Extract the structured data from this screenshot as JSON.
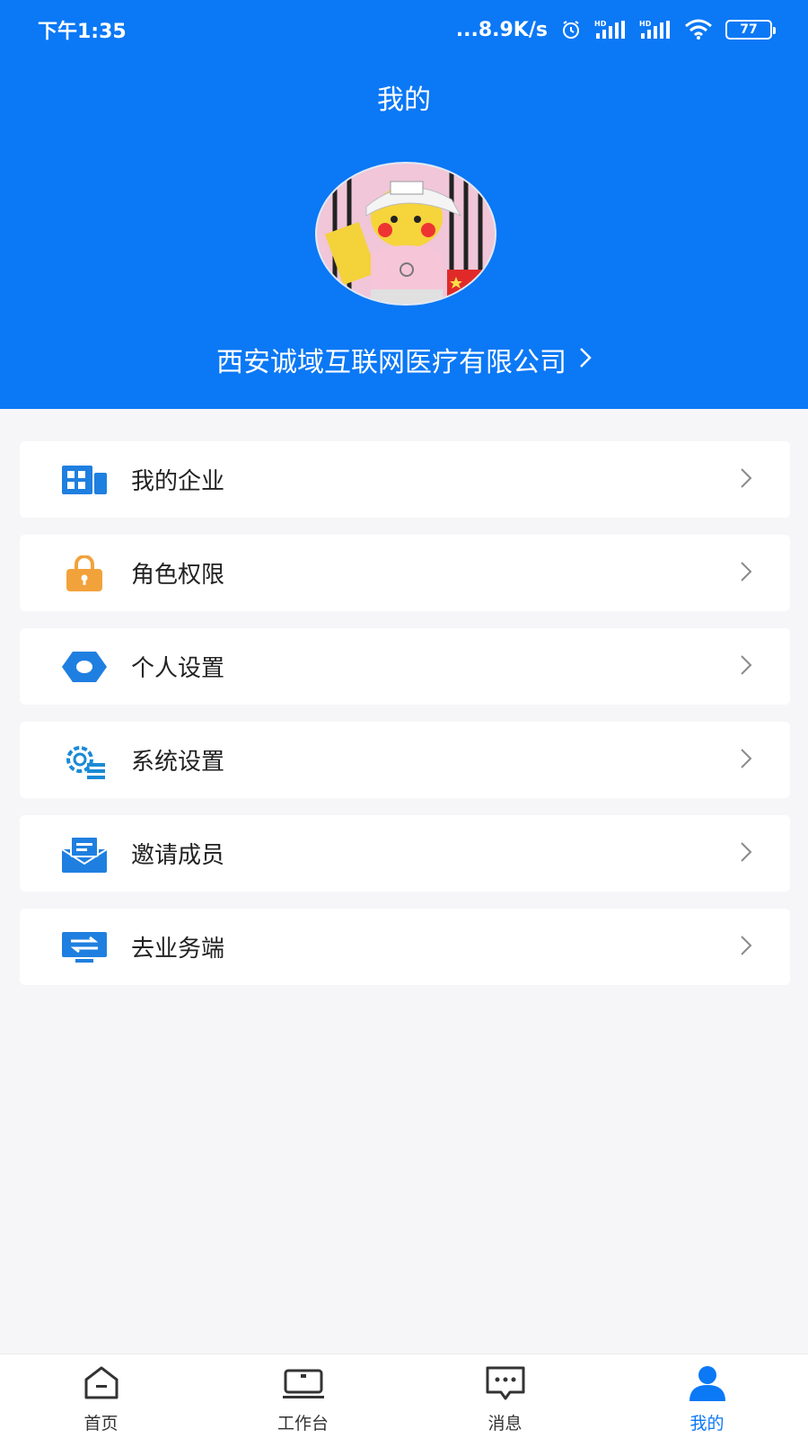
{
  "status_bar": {
    "time": "下午1:35",
    "network_speed": "...8.9K/s",
    "battery": "77",
    "icons": [
      "alarm-icon",
      "signal-hd-icon",
      "signal-hd-icon",
      "wifi-icon",
      "battery-icon"
    ]
  },
  "header": {
    "title": "我的",
    "company_name": "西安诚域互联网医疗有限公司",
    "accent_color": "#0b78f5"
  },
  "menu": {
    "items": [
      {
        "label": "我的企业",
        "icon": "building-icon"
      },
      {
        "label": "角色权限",
        "icon": "lock-icon"
      },
      {
        "label": "个人设置",
        "icon": "hexagon-settings-icon"
      },
      {
        "label": "系统设置",
        "icon": "gear-list-icon"
      },
      {
        "label": "邀请成员",
        "icon": "invite-mail-icon"
      },
      {
        "label": "去业务端",
        "icon": "monitor-switch-icon"
      }
    ]
  },
  "tabbar": {
    "tabs": [
      {
        "label": "首页",
        "icon": "home-icon"
      },
      {
        "label": "工作台",
        "icon": "workbench-icon"
      },
      {
        "label": "消息",
        "icon": "message-icon"
      },
      {
        "label": "我的",
        "icon": "user-icon",
        "active": true
      }
    ]
  }
}
